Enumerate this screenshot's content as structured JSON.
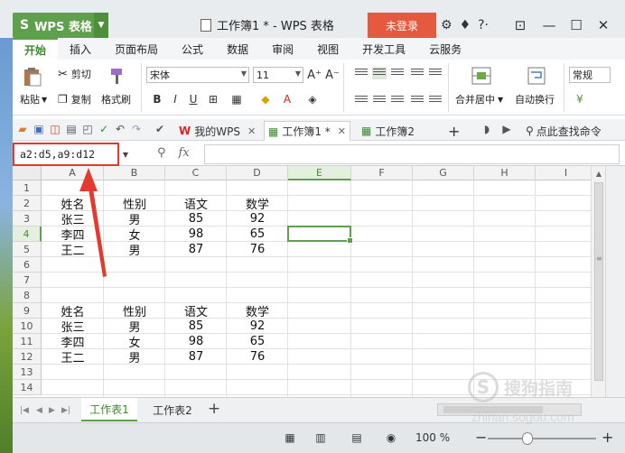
{
  "titlebar": {
    "app_name": "WPS 表格",
    "app_logo": "S",
    "document_title": "工作簿1 * - WPS 表格",
    "login_label": "未登录",
    "icons": [
      "skin-icon",
      "shirt-icon",
      "help-icon",
      "minimize-ribbon-icon",
      "minimize-icon",
      "maximize-icon",
      "close-icon"
    ]
  },
  "menu": {
    "tabs": [
      {
        "label": "开始",
        "active": true
      },
      {
        "label": "插入"
      },
      {
        "label": "页面布局"
      },
      {
        "label": "公式"
      },
      {
        "label": "数据"
      },
      {
        "label": "审阅"
      },
      {
        "label": "视图"
      },
      {
        "label": "开发工具"
      },
      {
        "label": "云服务"
      }
    ]
  },
  "ribbon": {
    "paste": "粘贴",
    "cut": "剪切",
    "copy": "复制",
    "format_painter": "格式刷",
    "font_name": "宋体",
    "font_size": "11",
    "bold": "B",
    "italic": "I",
    "underline": "U",
    "merge_center": "合并居中",
    "wrap_text": "自动换行",
    "number_format": "常规",
    "increase_font": "A⁺",
    "decrease_font": "A⁻"
  },
  "doc_tabs": {
    "my_wps": "我的WPS",
    "tabs": [
      {
        "label": "工作簿1 *",
        "active": true
      },
      {
        "label": "工作簿2"
      }
    ],
    "find_command": "点此查找命令",
    "add": "+"
  },
  "formula_bar": {
    "name_box_value": "a2:d5,a9:d12",
    "fx_label": "fx",
    "formula_value": ""
  },
  "grid": {
    "columns": [
      "A",
      "B",
      "C",
      "D",
      "E",
      "F",
      "G",
      "H",
      "I"
    ],
    "selected_column": "E",
    "rows": [
      "1",
      "2",
      "3",
      "4",
      "5",
      "6",
      "7",
      "8",
      "9",
      "10",
      "11",
      "12",
      "13",
      "14"
    ],
    "selected_row": "4",
    "active_cell": "E4",
    "cells": {
      "r2": [
        "姓名",
        "性别",
        "语文",
        "数学"
      ],
      "r3": [
        "张三",
        "男",
        "85",
        "92"
      ],
      "r4": [
        "李四",
        "女",
        "98",
        "65"
      ],
      "r5": [
        "王二",
        "男",
        "87",
        "76"
      ],
      "r9": [
        "姓名",
        "性别",
        "语文",
        "数学"
      ],
      "r10": [
        "张三",
        "男",
        "85",
        "92"
      ],
      "r11": [
        "李四",
        "女",
        "98",
        "65"
      ],
      "r12": [
        "王二",
        "男",
        "87",
        "76"
      ]
    }
  },
  "sheets": {
    "tabs": [
      {
        "label": "工作表1",
        "active": true
      },
      {
        "label": "工作表2"
      }
    ],
    "add": "+"
  },
  "statusbar": {
    "zoom": "100 %",
    "minus": "−",
    "plus": "+"
  },
  "watermark": {
    "text": "搜狗指南",
    "url": "zhinan.sogou.com"
  },
  "colors": {
    "accent_green": "#5ea04b",
    "login_red": "#e5593f",
    "annotation_red": "#e23a2e"
  }
}
